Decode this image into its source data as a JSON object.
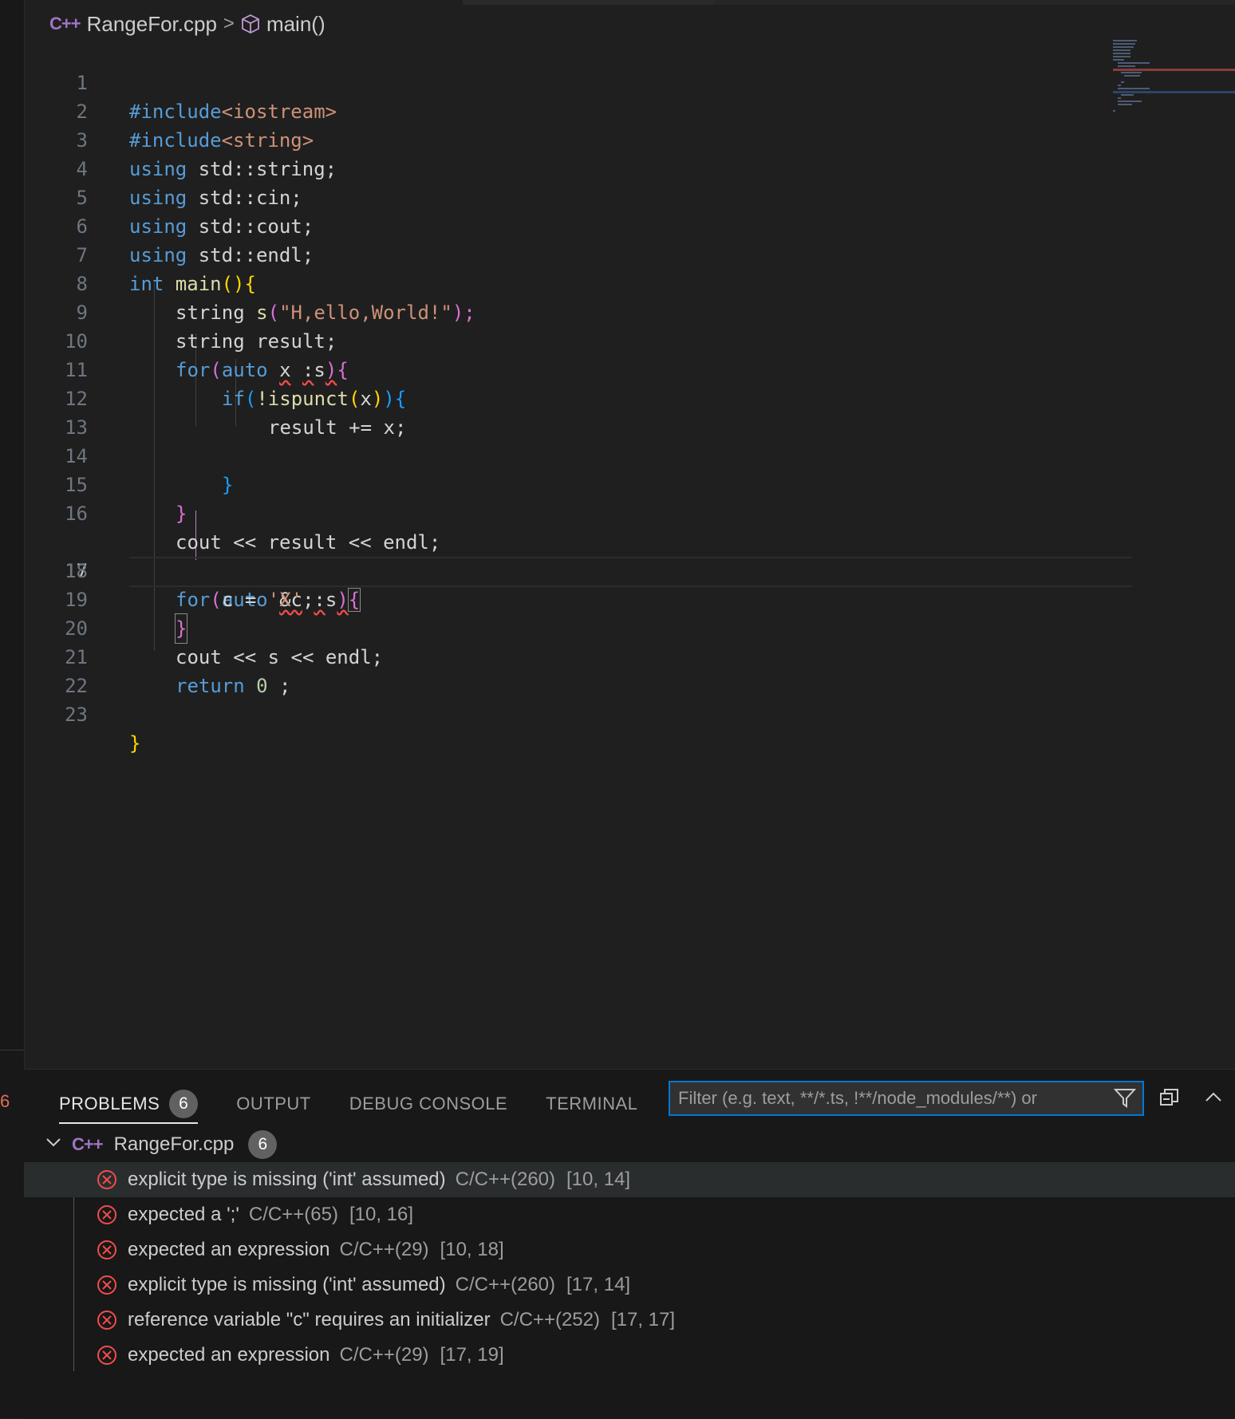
{
  "breadcrumb": {
    "file_icon": "C++",
    "file": "RangeFor.cpp",
    "separator": ">",
    "symbol": "main()"
  },
  "editor": {
    "active_line": 17,
    "lines": [
      {
        "n": "1"
      },
      {
        "n": "2"
      },
      {
        "n": "3"
      },
      {
        "n": "4"
      },
      {
        "n": "5"
      },
      {
        "n": "6"
      },
      {
        "n": "7"
      },
      {
        "n": "8"
      },
      {
        "n": "9"
      },
      {
        "n": "10"
      },
      {
        "n": "11"
      },
      {
        "n": "12"
      },
      {
        "n": "13"
      },
      {
        "n": "14"
      },
      {
        "n": "15"
      },
      {
        "n": "16"
      },
      {
        "n": "17"
      },
      {
        "n": "18"
      },
      {
        "n": "19"
      },
      {
        "n": "20"
      },
      {
        "n": "21"
      },
      {
        "n": "22"
      },
      {
        "n": "23"
      }
    ],
    "code": {
      "l1": [
        "#include",
        "<iostream>"
      ],
      "l2": [
        "#include",
        "<string>"
      ],
      "l3": [
        "using",
        " std::string;"
      ],
      "l4": [
        "using",
        " std::cin;"
      ],
      "l5": [
        "using",
        " std::cout;"
      ],
      "l6": [
        "using",
        " std::endl;"
      ],
      "l7": [
        "int",
        " main",
        "()",
        "{"
      ],
      "l8": [
        "string",
        " s",
        "(",
        "\"H,ello,World!\"",
        ");"
      ],
      "l9": [
        "string",
        " result;"
      ],
      "l10": [
        "for",
        "(",
        "auto",
        " ",
        "x",
        " ",
        ":",
        "s",
        ")",
        "{"
      ],
      "l11": [
        "if",
        "(",
        "!ispunct",
        "(",
        "x",
        ")",
        ")",
        "{"
      ],
      "l12": [
        "result += x;"
      ],
      "l14": [
        "}"
      ],
      "l15": [
        "}"
      ],
      "l16": [
        "cout << result << endl;"
      ],
      "l17": [
        "for",
        "(",
        "auto",
        " ",
        "&c",
        " ",
        ":",
        "s",
        ")",
        "{"
      ],
      "l18": [
        "c = ",
        "'X'",
        ";"
      ],
      "l19": [
        "}"
      ],
      "l20": [
        "cout << s << endl;"
      ],
      "l21": [
        "return",
        " ",
        "0",
        " ;"
      ],
      "l23": [
        "}"
      ]
    }
  },
  "panel": {
    "tabs": {
      "problems": "PROBLEMS",
      "problems_count": "6",
      "output": "OUTPUT",
      "debug_console": "DEBUG CONSOLE",
      "terminal": "TERMINAL"
    },
    "filter_placeholder": "Filter (e.g. text, **/*.ts, !**/node_modules/**) or",
    "file_group": {
      "icon": "C++",
      "name": "RangeFor.cpp",
      "count": "6"
    },
    "problems": [
      {
        "message": "explicit type is missing ('int' assumed)",
        "source": "C/C++(260)",
        "position": "[10, 14]"
      },
      {
        "message": "expected a ';'",
        "source": "C/C++(65)",
        "position": "[10, 16]"
      },
      {
        "message": "expected an expression",
        "source": "C/C++(29)",
        "position": "[10, 18]"
      },
      {
        "message": "explicit type is missing ('int' assumed)",
        "source": "C/C++(260)",
        "position": "[17, 14]"
      },
      {
        "message": "reference variable \"c\" requires an initializer",
        "source": "C/C++(252)",
        "position": "[17, 17]"
      },
      {
        "message": "expected an expression",
        "source": "C/C++(29)",
        "position": "[17, 19]"
      }
    ]
  },
  "left_strip_mark": "6",
  "colors": {
    "accent": "#0078d4",
    "error": "#f14c4c",
    "background": "#1f1f1f"
  }
}
